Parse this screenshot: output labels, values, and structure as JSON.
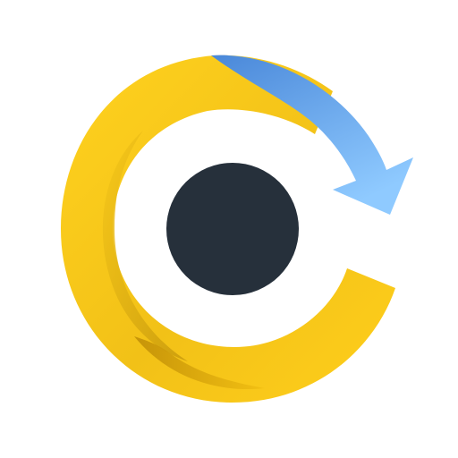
{
  "logo": {
    "icon": "refresh-eye-icon",
    "colors": {
      "background": "#ffffff",
      "ring_light": "#ffd21f",
      "ring_mid": "#f4c21a",
      "ring_dark": "#c99a0c",
      "arrow_top": "#4f8fde",
      "arrow_bottom": "#8cc6ff",
      "pupil": "#26303b"
    }
  }
}
